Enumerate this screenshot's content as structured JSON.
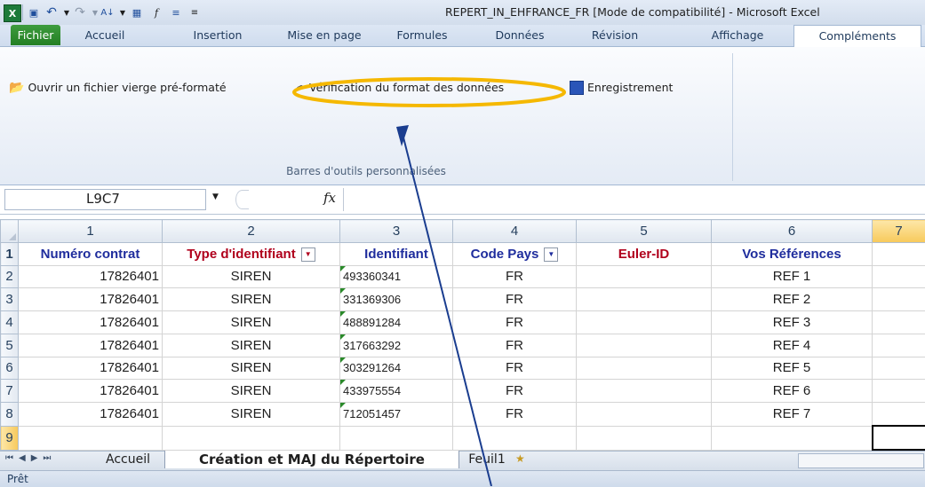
{
  "window": {
    "title": "REPERT_IN_EHFRANCE_FR  [Mode de compatibilité]  -  Microsoft Excel"
  },
  "ribbon": {
    "tabs": [
      "Fichier",
      "Accueil",
      "Insertion",
      "Mise en page",
      "Formules",
      "Données",
      "Révision",
      "Affichage",
      "Compléments"
    ],
    "active_tab": "Compléments",
    "buttons": {
      "open_template": "Ouvrir un fichier vierge pré-formaté",
      "verify_format": "Vérification du format des données",
      "save": "Enregistrement"
    },
    "group_label": "Barres d'outils personnalisées"
  },
  "formula_bar": {
    "name_box": "L9C7",
    "fx_label": "fx",
    "value": ""
  },
  "grid": {
    "column_headers": [
      "1",
      "2",
      "3",
      "4",
      "5",
      "6",
      "7"
    ],
    "row_headers": [
      "1",
      "2",
      "3",
      "4",
      "5",
      "6",
      "7",
      "8",
      "9"
    ],
    "header_row": [
      "Numéro contrat",
      "Type d'identifiant",
      "Identifiant",
      "Code Pays",
      "Euler-ID",
      "Vos Références"
    ],
    "rows": [
      [
        "17826401",
        "SIREN",
        "493360341",
        "FR",
        "",
        "REF 1"
      ],
      [
        "17826401",
        "SIREN",
        "331369306",
        "FR",
        "",
        "REF 2"
      ],
      [
        "17826401",
        "SIREN",
        "488891284",
        "FR",
        "",
        "REF 3"
      ],
      [
        "17826401",
        "SIREN",
        "317663292",
        "FR",
        "",
        "REF 4"
      ],
      [
        "17826401",
        "SIREN",
        "303291264",
        "FR",
        "",
        "REF 5"
      ],
      [
        "17826401",
        "SIREN",
        "433975554",
        "FR",
        "",
        "REF 6"
      ],
      [
        "17826401",
        "SIREN",
        "712051457",
        "FR",
        "",
        "REF 7"
      ]
    ]
  },
  "sheets": {
    "tabs": [
      "Accueil",
      "Création et MAJ du Répertoire",
      "Feuil1"
    ],
    "active": "Création et MAJ du Répertoire"
  },
  "status": {
    "text": "Prêt"
  },
  "colors": {
    "file_tab": "#2f8f2f",
    "highlight_ellipse": "#f5b800",
    "annotation_arrow": "#1a3d8f"
  }
}
